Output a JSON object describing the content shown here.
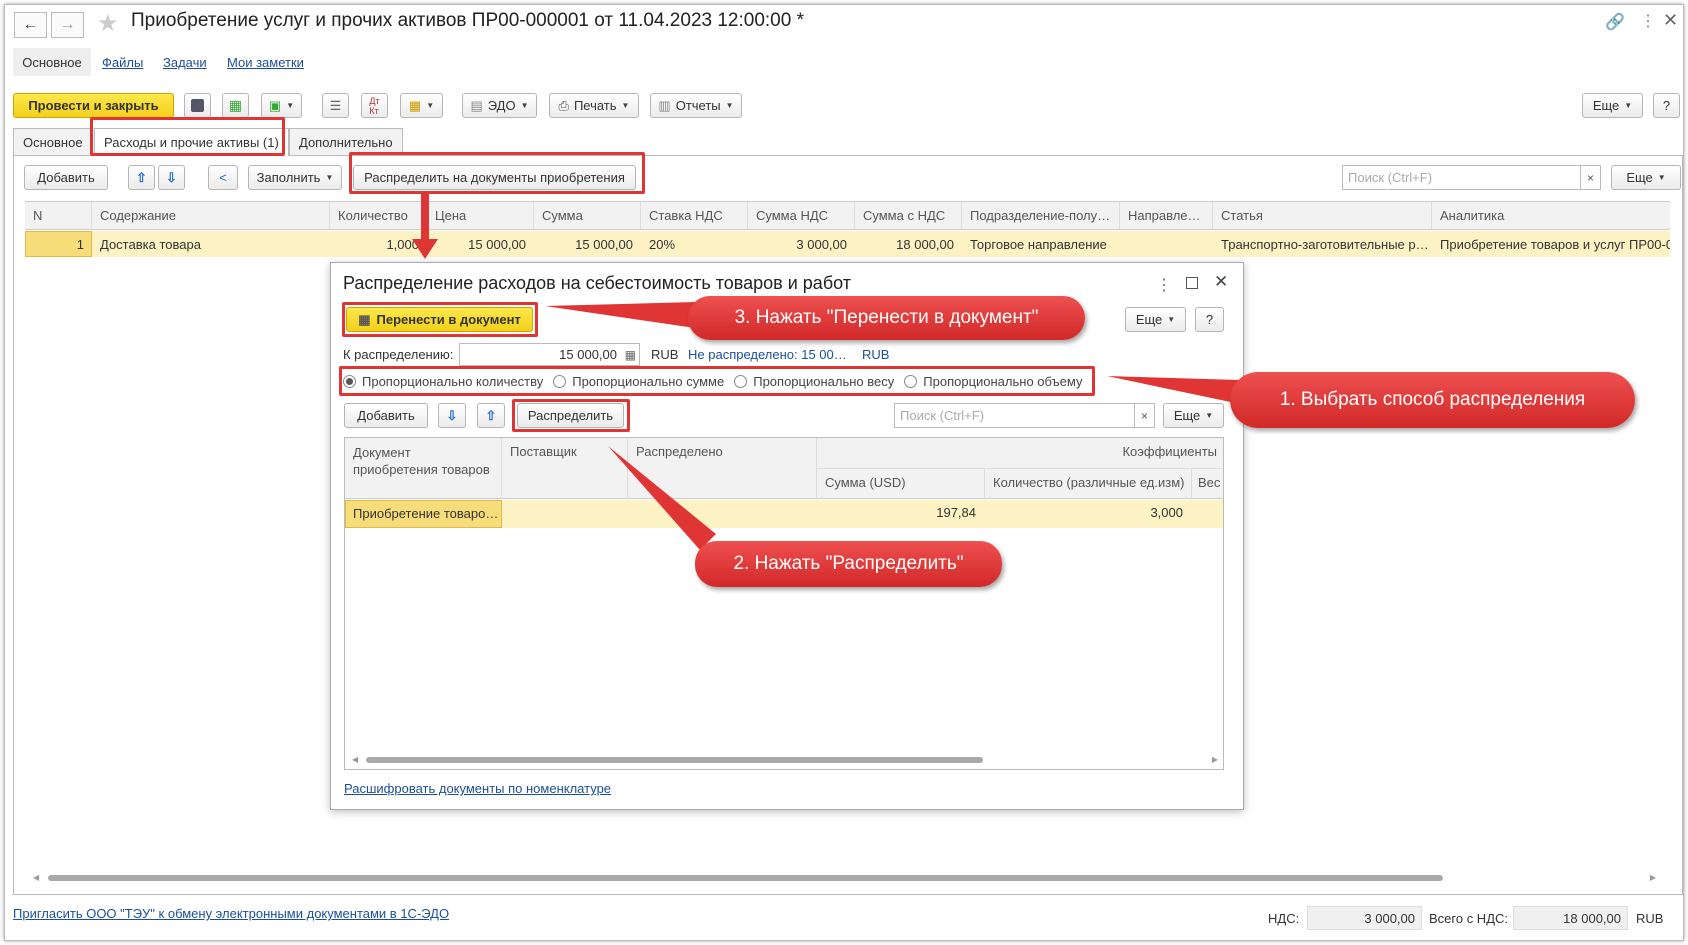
{
  "window": {
    "title": "Приобретение услуг и прочих активов ПР00-000001 от 11.04.2023 12:00:00 *"
  },
  "nav_tabs": [
    "Основное",
    "Файлы",
    "Задачи",
    "Мои заметки"
  ],
  "toolbar": {
    "post_close": "Провести и закрыть",
    "edo": "ЭДО",
    "print": "Печать",
    "reports": "Отчеты",
    "more": "Еще",
    "help": "?"
  },
  "doc_tabs": [
    "Основное",
    "Расходы и прочие активы (1)",
    "Дополнительно"
  ],
  "grid_toolbar": {
    "add": "Добавить",
    "fill": "Заполнить",
    "distribute_docs": "Распределить на документы приобретения",
    "search_placeholder": "Поиск (Ctrl+F)",
    "more": "Еще"
  },
  "grid": {
    "columns": [
      "N",
      "Содержание",
      "Количество",
      "Цена",
      "Сумма",
      "Ставка НДС",
      "Сумма НДС",
      "Сумма с НДС",
      "Подразделение-полу…",
      "Направле…",
      "Статья",
      "Аналитика"
    ],
    "rows": [
      {
        "n": "1",
        "content": "Доставка товара",
        "qty": "1,000",
        "price": "15 000,00",
        "sum": "15 000,00",
        "vat_rate": "20%",
        "vat": "3 000,00",
        "total": "18 000,00",
        "dept": "Торговое направление",
        "direction": "",
        "item": "Транспортно-заготовительные р…",
        "analytics": "Приобретение товаров и услуг ПР00-0"
      }
    ]
  },
  "dialog": {
    "title": "Распределение расходов на себестоимость товаров и работ",
    "transfer": "Перенести в документ",
    "more": "Еще",
    "help": "?",
    "to_distribute_label": "К распределению:",
    "to_distribute_value": "15 000,00",
    "currency": "RUB",
    "undistributed": "Не распределено: 15 00…",
    "undistributed_currency": "RUB",
    "methods": [
      {
        "label": "Пропорционально количеству",
        "selected": true
      },
      {
        "label": "Пропорционально сумме",
        "selected": false
      },
      {
        "label": "Пропорционально весу",
        "selected": false
      },
      {
        "label": "Пропорционально объему",
        "selected": false
      }
    ],
    "add": "Добавить",
    "distribute": "Распределить",
    "search_placeholder": "Поиск (Ctrl+F)",
    "col_doc": "Документ приобретения товаров",
    "col_supplier": "Поставщик",
    "col_distributed": "Распределено",
    "col_coeffs": "Коэффициенты",
    "col_sum": "Сумма (USD)",
    "col_qty": "Количество (различные ед.изм)",
    "col_weight": "Вес",
    "rows": [
      {
        "doc": "Приобретение товаро…",
        "supplier": "",
        "distributed": "",
        "sum": "197,84",
        "qty": "3,000"
      }
    ],
    "decode_link": "Расшифровать документы по номенклатуре"
  },
  "callouts": {
    "c1": "1. Выбрать способ распределения",
    "c2": "2. Нажать \"Распределить\"",
    "c3": "3. Нажать \"Перенести в документ\""
  },
  "footer": {
    "invite": "Пригласить ООО \"ТЭУ\" к обмену электронными документами в 1С-ЭДО",
    "vat_label": "НДС:",
    "vat_value": "3 000,00",
    "total_label": "Всего с НДС:",
    "total_value": "18 000,00",
    "currency": "RUB"
  },
  "colors": {
    "accent_yellow": "#f4d01c",
    "selected_row": "#fdf2c4",
    "callout_red": "#e03535",
    "link": "#1b4f9c"
  }
}
